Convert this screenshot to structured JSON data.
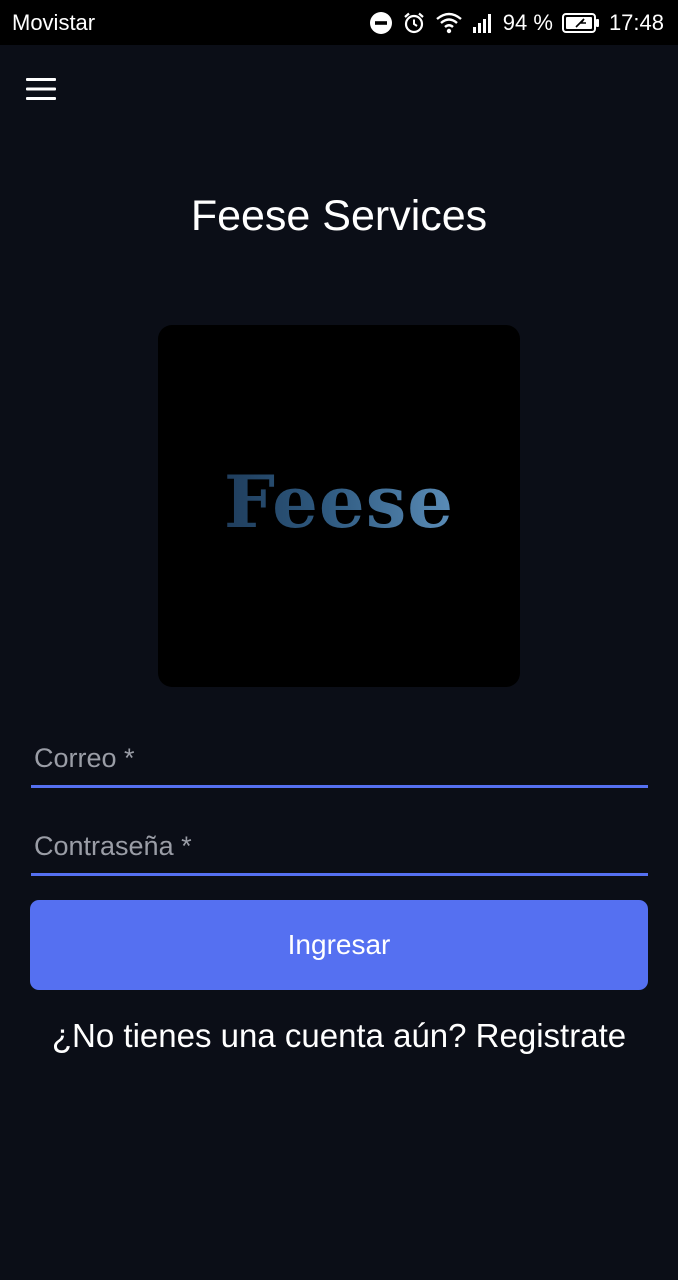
{
  "status_bar": {
    "carrier": "Movistar",
    "battery_percent": "94 %",
    "time": "17:48",
    "icons": [
      "do-not-disturb-icon",
      "alarm-icon",
      "wifi-icon",
      "signal-icon",
      "battery-icon"
    ]
  },
  "app_bar": {
    "menu_icon": "hamburger-menu-icon"
  },
  "title": "Feese Services",
  "logo": {
    "text": "Feese"
  },
  "form": {
    "email_placeholder": "Correo *",
    "password_placeholder": "Contraseña *",
    "submit_label": "Ingresar"
  },
  "register_prompt": "¿No tienes una cuenta aún? Registrate",
  "colors": {
    "background": "#0b0e17",
    "accent": "#5570f1",
    "status_bar": "#000000"
  }
}
